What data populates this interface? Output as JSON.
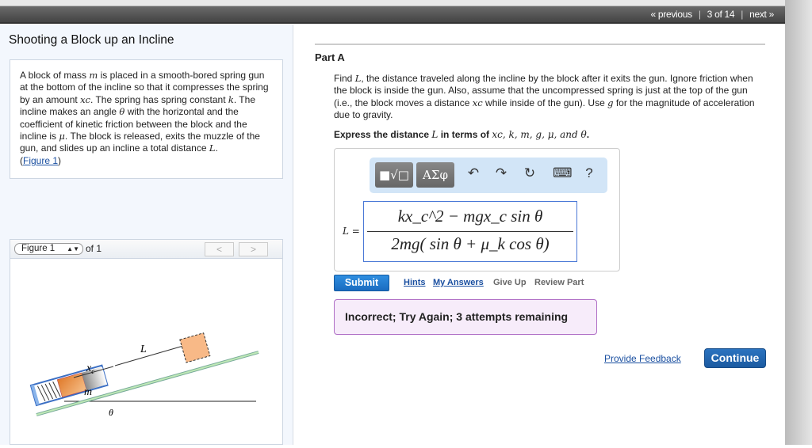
{
  "nav": {
    "previous": "« previous",
    "position": "3 of 14",
    "next": "next »"
  },
  "title": "Shooting a Block up an Incline",
  "problem": {
    "p1": "A block of mass ",
    "m": "m",
    "p2": " is placed in a smooth-bored spring gun at the bottom of the incline so that it compresses the spring by an amount ",
    "xc": "xc",
    "p3": ". The spring has spring constant ",
    "k": "k",
    "p4": ". The incline makes an angle ",
    "theta": "θ",
    "p5": " with the horizontal and the coefficient of kinetic friction between the block and the incline is ",
    "mu": "μ",
    "p6": ". The block is released, exits the muzzle of the gun, and slides up an incline a total distance ",
    "L": "L",
    "p7": ".",
    "figure_link": "Figure 1"
  },
  "figure": {
    "select": "Figure 1",
    "of": "of 1",
    "prev": "<",
    "next": ">",
    "labels": {
      "L": "L",
      "xc": "x",
      "xc_sub": "c",
      "m": "m",
      "theta": "θ"
    }
  },
  "part": "Part A",
  "question": {
    "q1": "Find ",
    "L": "L",
    "q2": ", the distance traveled along the incline by the block after it exits the gun. Ignore friction when the block is inside the gun. Also, assume that the uncompressed spring is just at the top of the gun (i.e., the block moves a distance ",
    "xc": "xc",
    "q3": " while inside of the gun). Use ",
    "g": "g",
    "q4": " for the magnitude of acceleration due to gravity."
  },
  "express": {
    "t1": "Express the distance ",
    "L": "L",
    "t2": " in terms of ",
    "vars": "xc, k, m, g, μ, and θ",
    "t3": "."
  },
  "toolbar": {
    "templates": "■√□",
    "greek": "ΑΣφ",
    "undo": "↶",
    "redo": "↷",
    "reset": "↻",
    "keyboard": "⌨",
    "help": "?"
  },
  "answer": {
    "label": "L =",
    "numerator": "kx_c^2 − mgx_c sin θ",
    "denominator": "2mg( sin θ + μ_k cos θ)"
  },
  "actions": {
    "submit": "Submit",
    "hints": "Hints",
    "my_answers": "My Answers",
    "give_up": "Give Up",
    "review": "Review Part"
  },
  "feedback_msg": "Incorrect; Try Again; 3 attempts remaining",
  "provide_feedback": "Provide Feedback",
  "continue": "Continue"
}
